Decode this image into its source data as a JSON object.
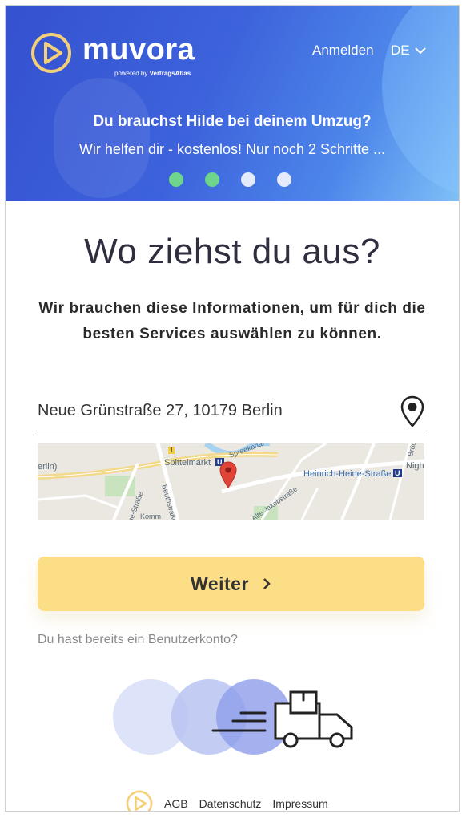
{
  "header": {
    "brand": "muvora",
    "powered_prefix": "powered by",
    "powered_brand": "VertragsAtlas",
    "login_label": "Anmelden",
    "language": "DE",
    "title": "Du brauchst Hilde bei deinem Umzug?",
    "subtitle": "Wir helfen dir - kostenlos! Nur noch 2 Schritte ...",
    "carousel": {
      "total": 4,
      "active_steps": [
        1,
        2
      ]
    }
  },
  "main": {
    "title": "Wo ziehst du aus?",
    "description": "Wir brauchen diese Informationen, um für dich die besten Services auswählen zu können.",
    "address_value": "Neue Grünstraße 27, 10179 Berlin",
    "map_labels": {
      "spittelmarkt": "Spittelmarkt",
      "heinrich": "Heinrich-Heine-Straße",
      "berlin_partial": "erlin)",
      "night_partial": "Nigh",
      "jakob": "Alte Jakobstraße",
      "spree": "Spreekanal",
      "beuth": "Beuthstraße",
      "strasse": "ge-Straße",
      "komm": "Komm",
      "brue": "Brüc",
      "one": "1",
      "u1": "U",
      "u2": "U"
    },
    "continue_label": "Weiter",
    "account_link": "Du hast bereits ein Benutzerkonto?"
  },
  "footer": {
    "links": [
      "AGB",
      "Datenschutz",
      "Impressum"
    ]
  },
  "colors": {
    "header_gradient_start": "#3551cf",
    "header_gradient_end": "#7fc0f7",
    "active_dot": "#6fd48c",
    "button": "#fbde85",
    "logo_gold": "#f4cf7a"
  },
  "icons": [
    "play-logo-icon",
    "chevron-down-icon",
    "location-pin-icon",
    "map-marker-icon",
    "chevron-right-icon",
    "moving-truck-icon"
  ]
}
